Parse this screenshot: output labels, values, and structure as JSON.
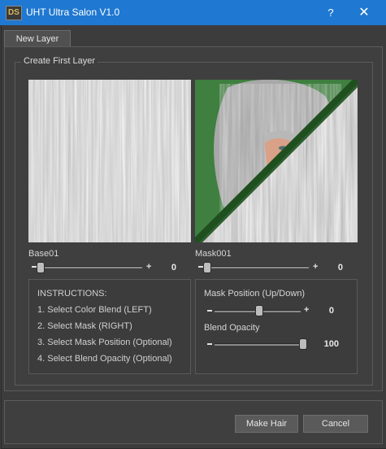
{
  "window": {
    "logo_text": "DS",
    "title": "UHT Ultra Salon V1.0",
    "help_glyph": "?",
    "close_glyph": "✕"
  },
  "tabs": [
    {
      "label": "New Layer",
      "selected": true
    }
  ],
  "group": {
    "title": "Create First Layer"
  },
  "base": {
    "label": "Base01",
    "minus": "−",
    "plus": "+",
    "value": "0"
  },
  "mask": {
    "label": "Mask001",
    "minus": "−",
    "plus": "+",
    "value": "0"
  },
  "instructions": {
    "heading": "INSTRUCTIONS:",
    "steps": [
      "1. Select Color Blend (LEFT)",
      "2. Select Mask (RIGHT)",
      "3. Select Mask Position (Optional)",
      "4. Select Blend Opacity (Optional)"
    ]
  },
  "mask_position": {
    "label": "Mask Position (Up/Down)",
    "value": "0"
  },
  "blend_opacity": {
    "label": "Blend Opacity",
    "value": "100"
  },
  "buttons": {
    "make_hair": "Make Hair",
    "cancel": "Cancel"
  },
  "colors": {
    "titlebar": "#1f78d1",
    "background": "#3c3c3c",
    "mask_green": "#3a7a3a"
  }
}
